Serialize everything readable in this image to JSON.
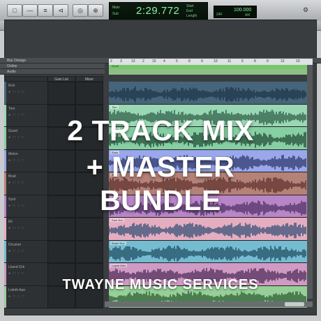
{
  "toolbar": {
    "buttons": [
      "□",
      "—",
      "≡",
      "⊲",
      "◎",
      "⊕",
      "▣",
      "⊘"
    ],
    "counter": {
      "main": "2:29.772",
      "left_labels": [
        "Main",
        "Sub"
      ],
      "right_labels": [
        "Start",
        "End",
        "Length"
      ]
    },
    "tempo": {
      "value": "100.000",
      "meter": "24F",
      "label": "4/4"
    }
  },
  "subbar": {
    "buttons": [
      "⇆",
      "B",
      "B",
      "0",
      "13"
    ]
  },
  "headers": {
    "blur": "Blur Distage",
    "online": "Online",
    "audio": "Audio"
  },
  "ruler": {
    "ticks": [
      "2",
      "3",
      "13",
      "2",
      "15",
      "4",
      "5",
      "8",
      "9",
      "10",
      "11",
      "5",
      "8",
      "9",
      "12",
      "10"
    ]
  },
  "markers": {
    "label": "Scroll"
  },
  "columns": {
    "gain": "Gain List",
    "mixer": "Mixer"
  },
  "tracks": [
    {
      "name": "Kick",
      "lane_label": "",
      "color": "#47657a",
      "wave": "#1c3348"
    },
    {
      "name": "Tom",
      "lane_label": "Tom",
      "color": "#9ad7b3",
      "wave": "#2c5a45"
    },
    {
      "name": "Guvel",
      "lane_label": "Gund",
      "color": "#86cfa3",
      "wave": "#1f4734"
    },
    {
      "name": "Melon",
      "lane_label": "Eaus",
      "color": "#9aa7ea",
      "wave": "#2b3568"
    },
    {
      "name": "Brad",
      "lane_label": "Bwel",
      "color": "#b58278",
      "wave": "#5b2f2a"
    },
    {
      "name": "Synt",
      "lane_label": "Tinnal",
      "color": "#b886c6",
      "wave": "#4b2f63"
    },
    {
      "name": "Eli",
      "lane_label": "Eam Noc",
      "color": "#e5aec0",
      "wave": "#2f4d74"
    },
    {
      "name": "Drrumer",
      "lane_label": "Boam Noc",
      "color": "#75bcd2",
      "wave": "#1f4a5c"
    },
    {
      "name": "Lkand Grk",
      "lane_label": "Lrgnal Nels",
      "color": "#cf9ac4",
      "wave": "#4b2a55"
    },
    {
      "name": "Lrdnth Aan",
      "lane_label": "",
      "color": "#96cf98",
      "wave": "#2b5a30"
    }
  ],
  "overlay": {
    "title_lines": [
      "2 TRACK MIX",
      "+ MASTER",
      "BUNDLE"
    ],
    "footer": "TWAYNE MUSIC SERVICES"
  }
}
